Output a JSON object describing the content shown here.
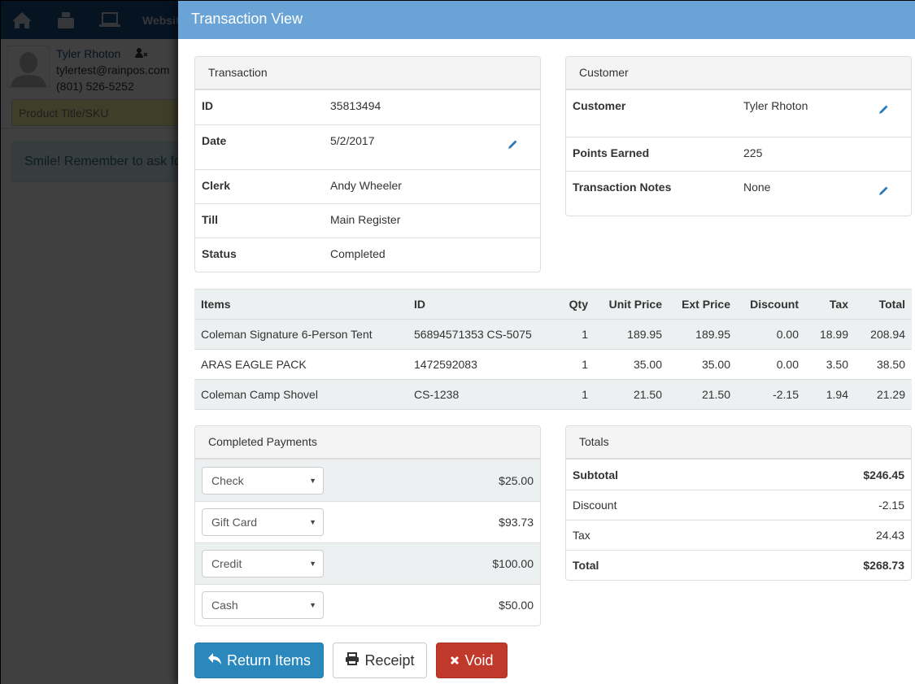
{
  "background": {
    "nav": {
      "website_label": "Websit"
    },
    "customer": {
      "name": "Tyler Rhoton",
      "email": "tylertest@rainpos.com",
      "phone": "(801) 526-5252"
    },
    "search": {
      "placeholder": "Product Title/SKU"
    },
    "alert": {
      "text": "Smile! Remember to ask fo"
    }
  },
  "modal": {
    "title": "Transaction View",
    "transaction": {
      "heading": "Transaction",
      "rows": [
        {
          "label": "ID",
          "value": "35813494"
        },
        {
          "label": "Date",
          "value": "5/2/2017"
        },
        {
          "label": "Clerk",
          "value": "Andy Wheeler"
        },
        {
          "label": "Till",
          "value": "Main Register"
        },
        {
          "label": "Status",
          "value": "Completed"
        }
      ]
    },
    "customer": {
      "heading": "Customer",
      "rows": [
        {
          "label": "Customer",
          "value": "Tyler Rhoton"
        },
        {
          "label": "Points Earned",
          "value": "225"
        },
        {
          "label": "Transaction Notes",
          "value": "None"
        }
      ]
    },
    "items": {
      "headers": [
        "Items",
        "ID",
        "Qty",
        "Unit Price",
        "Ext Price",
        "Discount",
        "Tax",
        "Total"
      ],
      "rows": [
        [
          "Coleman Signature 6-Person Tent",
          "56894571353 CS-5075",
          "1",
          "189.95",
          "189.95",
          "0.00",
          "18.99",
          "208.94"
        ],
        [
          "ARAS EAGLE PACK",
          "1472592083",
          "1",
          "35.00",
          "35.00",
          "0.00",
          "3.50",
          "38.50"
        ],
        [
          "Coleman Camp Shovel",
          "CS-1238",
          "1",
          "21.50",
          "21.50",
          "-2.15",
          "1.94",
          "21.29"
        ]
      ]
    },
    "payments": {
      "heading": "Completed Payments",
      "rows": [
        {
          "method": "Check",
          "amount": "$25.00"
        },
        {
          "method": "Gift Card",
          "amount": "$93.73"
        },
        {
          "method": "Credit",
          "amount": "$100.00"
        },
        {
          "method": "Cash",
          "amount": "$50.00"
        }
      ]
    },
    "totals": {
      "heading": "Totals",
      "rows": [
        {
          "label": "Subtotal",
          "value": "$246.45"
        },
        {
          "label": "Discount",
          "value": "-2.15"
        },
        {
          "label": "Tax",
          "value": "24.43"
        },
        {
          "label": "Total",
          "value": "$268.73"
        }
      ]
    },
    "buttons": {
      "return_label": "Return Items",
      "receipt_label": "Receipt",
      "void_label": "Void"
    }
  },
  "colors": {
    "header": "#6aa4d6",
    "primary": "#2a88bd",
    "danger": "#c0392b",
    "edit_icon": "#2a7ab8"
  }
}
